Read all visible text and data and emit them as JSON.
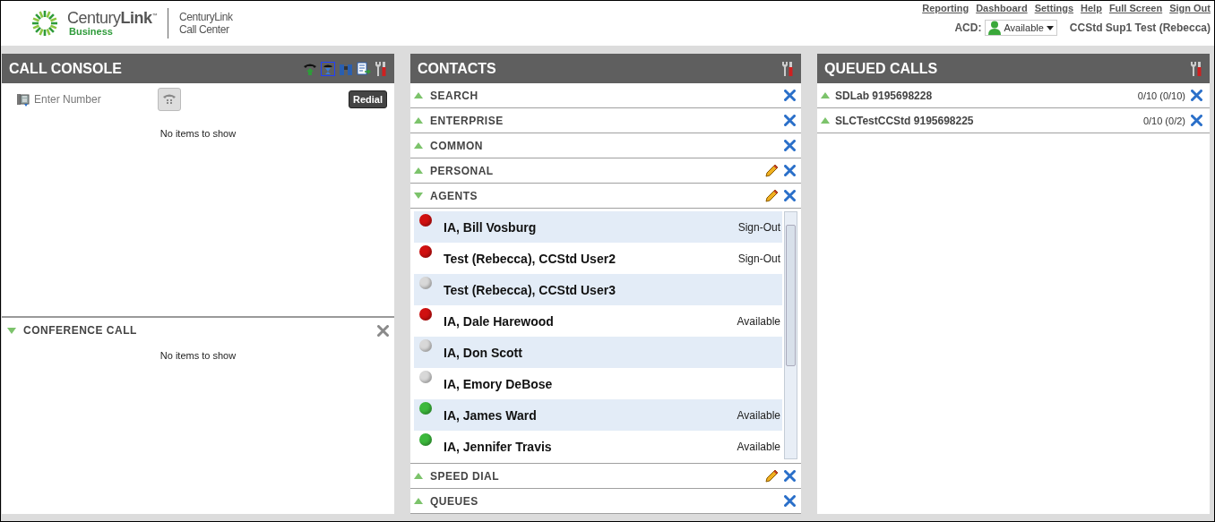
{
  "logo": {
    "brand": "Century**Link**$^{™}$",
    "tagline": "Business",
    "product_line1": "CenturyLink",
    "product_line2": "Call Center"
  },
  "nav_links": [
    "Reporting",
    "Dashboard",
    "Settings",
    "Help",
    "Full Screen",
    "Sign Out"
  ],
  "acd": {
    "label": "ACD:",
    "status": "Available",
    "user": "CCStd Sup1 Test (Rebecca)"
  },
  "call_console": {
    "title": "CALL CONSOLE",
    "placeholder": "Enter Number",
    "redial": "Redial",
    "empty": "No items to show",
    "conference": {
      "title": "CONFERENCE CALL",
      "expanded": true,
      "empty": "No items to show"
    }
  },
  "contacts": {
    "title": "CONTACTS",
    "sections": [
      {
        "label": "SEARCH",
        "expanded": false,
        "editable": false
      },
      {
        "label": "ENTERPRISE",
        "expanded": false,
        "editable": false
      },
      {
        "label": "COMMON",
        "expanded": false,
        "editable": false
      },
      {
        "label": "PERSONAL",
        "expanded": false,
        "editable": true
      },
      {
        "label": "AGENTS",
        "expanded": true,
        "editable": true,
        "agents": [
          {
            "name": "IA, Bill Vosburg",
            "status": "Sign-Out",
            "color": "#d01010"
          },
          {
            "name": "Test (Rebecca), CCStd User2",
            "status": "Sign-Out",
            "color": "#d01010"
          },
          {
            "name": "Test (Rebecca), CCStd User3",
            "color": "#d8d8d8"
          },
          {
            "name": "IA, Dale Harewood",
            "status": "Available",
            "color": "#d01010"
          },
          {
            "name": "IA, Don Scott",
            "color": "#d8d8d8"
          },
          {
            "name": "IA, Emory DeBose",
            "color": "#d8d8d8"
          },
          {
            "name": "IA, James Ward",
            "status": "Available",
            "color": "#3cb83c"
          },
          {
            "name": "IA, Jennifer Travis",
            "status": "Available",
            "color": "#3cb83c"
          }
        ]
      },
      {
        "label": "SPEED DIAL",
        "expanded": false,
        "editable": true
      },
      {
        "label": "QUEUES",
        "expanded": false,
        "editable": false
      }
    ]
  },
  "queued_calls": {
    "title": "QUEUED CALLS",
    "queues": [
      {
        "name": "SDLab 9195698228",
        "count": "0/10 (0/10)"
      },
      {
        "name": "SLCTestCCStd 9195698225",
        "count": "0/10 (0/2)"
      }
    ]
  }
}
